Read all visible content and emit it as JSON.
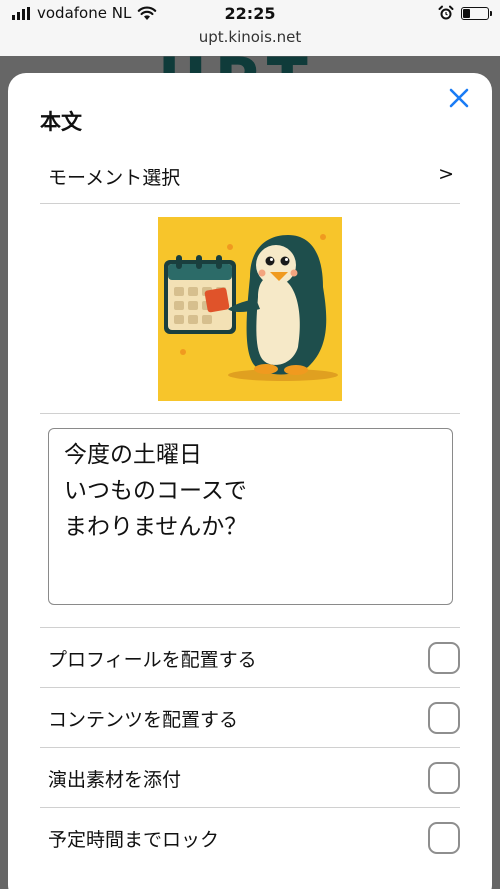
{
  "status": {
    "carrier": "vodafone NL",
    "time": "22:25",
    "battery_level": 0.3
  },
  "browser": {
    "url": "upt.kinois.net"
  },
  "background": {
    "logo_text": "UPT"
  },
  "sheet": {
    "title": "本文",
    "close_icon": "close-icon",
    "moment_select": {
      "label": "モーメント選択",
      "chevron": ">"
    },
    "image": {
      "icon": "penguin-calendar-illustration",
      "bg_color": "#f7c52b"
    },
    "message": "今度の土曜日\nいつものコースで\nまわりませんか？",
    "options": [
      {
        "label": "プロフィールを配置する",
        "checked": false
      },
      {
        "label": "コンテンツを配置する",
        "checked": false
      },
      {
        "label": "演出素材を添付",
        "checked": false
      },
      {
        "label": "予定時間までロック",
        "checked": false
      }
    ]
  },
  "colors": {
    "accent": "#1a7cf5",
    "overlay": "#666666",
    "divider": "#d0d0d0"
  }
}
